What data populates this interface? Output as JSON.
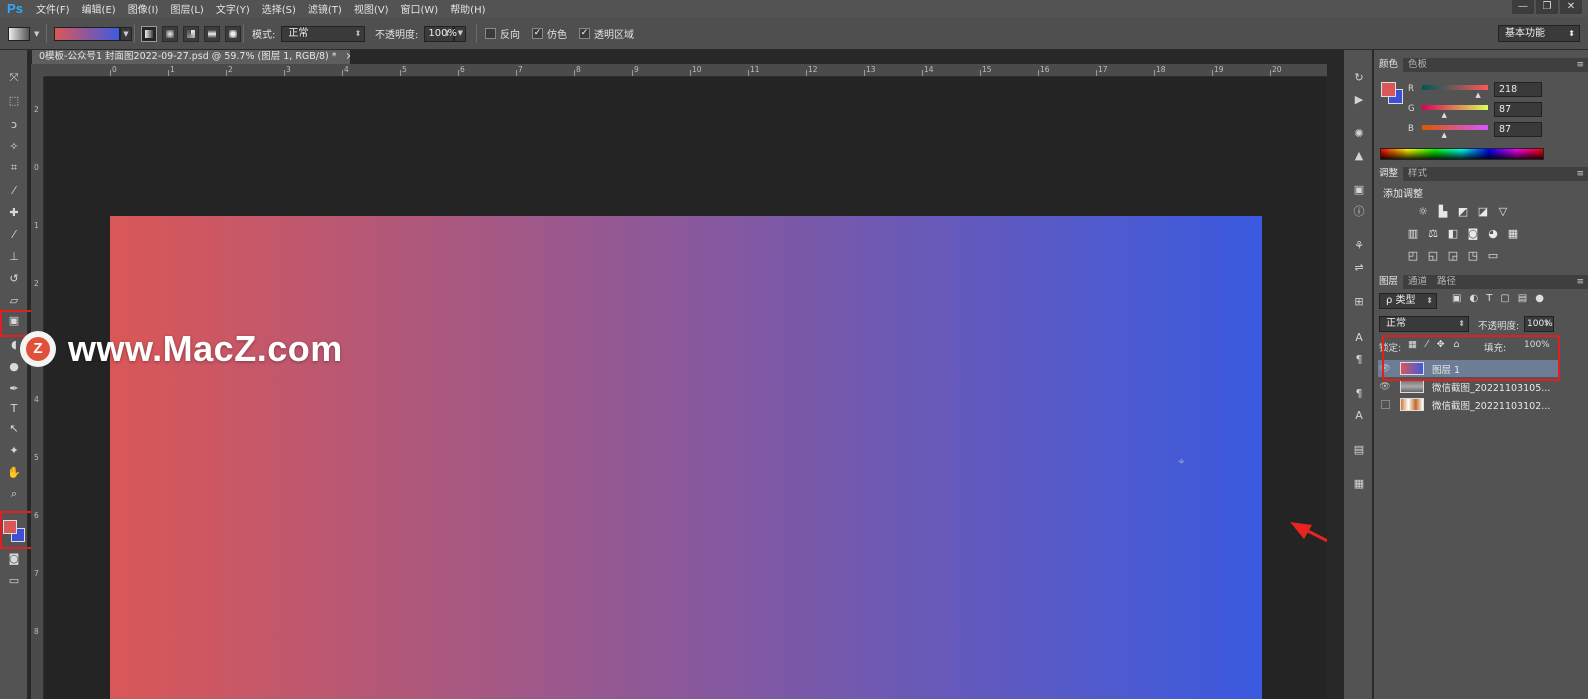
{
  "app": {
    "logo": "Ps"
  },
  "menu": [
    "文件(F)",
    "编辑(E)",
    "图像(I)",
    "图层(L)",
    "文字(Y)",
    "选择(S)",
    "滤镜(T)",
    "视图(V)",
    "窗口(W)",
    "帮助(H)"
  ],
  "window_controls": [
    "—",
    "❐",
    "✕"
  ],
  "options": {
    "mode_label": "模式:",
    "mode_value": "正常",
    "opacity_label": "不透明度:",
    "opacity_value": "100%",
    "reverse_label": "反向",
    "dither_label": "仿色",
    "transparency_label": "透明区域",
    "dither_checked": "✓",
    "transparency_checked": "✓",
    "workspace": "基本功能"
  },
  "document": {
    "tab_title": "0模板-公众号1 封面图2022-09-27.psd @ 59.7% (图层 1, RGB/8) *",
    "close": "×",
    "h_ticks": [
      "0",
      "1",
      "2",
      "3",
      "4",
      "5",
      "6",
      "7",
      "8",
      "9",
      "10",
      "11",
      "12",
      "13",
      "14",
      "15",
      "16",
      "17",
      "18",
      "19",
      "20"
    ],
    "v_ticks": [
      "2",
      "0",
      "1",
      "2",
      "3",
      "4",
      "5",
      "6",
      "7",
      "8"
    ],
    "gradient_start": "#da5757",
    "gradient_end": "#3a5ae0"
  },
  "watermark": {
    "logo_letter": "Z",
    "text": "www.MacZ.com"
  },
  "color_panel": {
    "tabs": [
      "颜色",
      "色板"
    ],
    "foreground": "#da5757",
    "background": "#3e4fd6",
    "channels": [
      {
        "label": "R",
        "value": "218",
        "level": 0.855
      },
      {
        "label": "G",
        "value": "87",
        "level": 0.341
      },
      {
        "label": "B",
        "value": "87",
        "level": 0.341
      }
    ]
  },
  "adjust_panel": {
    "tabs": [
      "调整",
      "样式"
    ],
    "title": "添加调整",
    "icons_row1": [
      "☼",
      "▙",
      "◩",
      "◪",
      "▽"
    ],
    "icons_row2": [
      "▥",
      "⚖",
      "◧",
      "◙",
      "◕",
      "▦"
    ],
    "icons_row3": [
      "◰",
      "◱",
      "◲",
      "◳",
      "▭"
    ]
  },
  "layers_panel": {
    "tabs": [
      "图层",
      "通道",
      "路径"
    ],
    "filter_label": "ρ 类型",
    "blend_mode": "正常",
    "opacity_label": "不透明度:",
    "opacity_value": "100%",
    "lock_label": "锁定:",
    "fill_label": "填充:",
    "fill_value": "100%",
    "layers": [
      {
        "name": "图层 1",
        "eye": "👁",
        "selected": true
      },
      {
        "name": "微信截图_20221103105...",
        "eye": "👁",
        "selected": false
      },
      {
        "name": "微信截图_20221103102...",
        "eye": "",
        "selected": false
      }
    ]
  },
  "toolbar": {
    "tools": [
      {
        "name": "move-tool-icon",
        "glyph": "⤧"
      },
      {
        "name": "marquee-tool-icon",
        "glyph": "⬚"
      },
      {
        "name": "lasso-tool-icon",
        "glyph": "ↄ"
      },
      {
        "name": "magic-wand-tool-icon",
        "glyph": "✧"
      },
      {
        "name": "crop-tool-icon",
        "glyph": "⌗"
      },
      {
        "name": "eyedropper-tool-icon",
        "glyph": "⁄"
      },
      {
        "name": "healing-tool-icon",
        "glyph": "✚"
      },
      {
        "name": "brush-tool-icon",
        "glyph": "⁄"
      },
      {
        "name": "stamp-tool-icon",
        "glyph": "⊥"
      },
      {
        "name": "history-brush-tool-icon",
        "glyph": "↺"
      },
      {
        "name": "eraser-tool-icon",
        "glyph": "▱"
      },
      {
        "name": "gradient-tool-icon",
        "glyph": "▣"
      },
      {
        "name": "blur-tool-icon",
        "glyph": "◖"
      },
      {
        "name": "dodge-tool-icon",
        "glyph": "●"
      },
      {
        "name": "pen-tool-icon",
        "glyph": "✒"
      },
      {
        "name": "type-tool-icon",
        "glyph": "T"
      },
      {
        "name": "path-select-tool-icon",
        "glyph": "↖"
      },
      {
        "name": "shape-tool-icon",
        "glyph": "✦"
      },
      {
        "name": "hand-tool-icon",
        "glyph": "✋"
      },
      {
        "name": "zoom-tool-icon",
        "glyph": "⌕"
      }
    ]
  }
}
